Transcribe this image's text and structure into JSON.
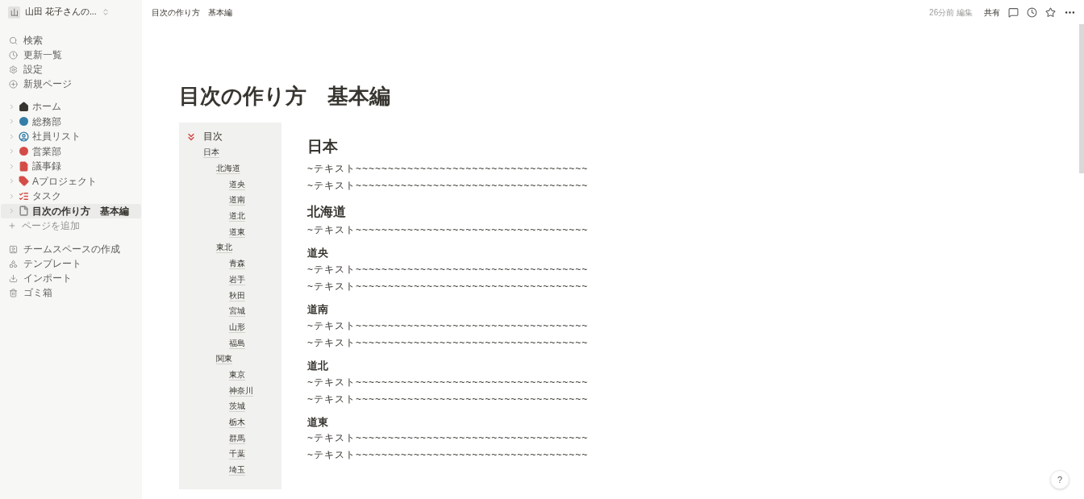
{
  "workspace": {
    "avatar": "山",
    "name": "山田 花子さんの..."
  },
  "breadcrumb": "目次の作り方　基本編",
  "topbar": {
    "edited": "26分前 編集",
    "share": "共有"
  },
  "nav": [
    {
      "kind": "search",
      "label": "検索"
    },
    {
      "kind": "updates",
      "label": "更新一覧"
    },
    {
      "kind": "settings",
      "label": "設定"
    },
    {
      "kind": "new",
      "label": "新規ページ"
    }
  ],
  "pages": [
    {
      "kind": "home",
      "label": "ホーム",
      "color": "#37352f",
      "selected": false
    },
    {
      "kind": "dot",
      "label": "総務部",
      "color": "#337ea9",
      "selected": false
    },
    {
      "kind": "person",
      "label": "社員リスト",
      "color": "#337ea9",
      "selected": false
    },
    {
      "kind": "dot",
      "label": "営業部",
      "color": "#d44c47",
      "selected": false
    },
    {
      "kind": "doc",
      "label": "議事録",
      "color": "#d44c47",
      "selected": false
    },
    {
      "kind": "tag",
      "label": "Aプロジェクト",
      "color": "#d44c47",
      "selected": false
    },
    {
      "kind": "tasks",
      "label": "タスク",
      "color": "#d44c47",
      "selected": false
    },
    {
      "kind": "page",
      "label": "目次の作り方　基本編",
      "color": "#91918e",
      "selected": true
    }
  ],
  "add_page": "ページを追加",
  "footer_nav": [
    {
      "kind": "teamspace",
      "label": "チームスペースの作成"
    },
    {
      "kind": "template",
      "label": "テンプレート"
    },
    {
      "kind": "import",
      "label": "インポート"
    },
    {
      "kind": "trash",
      "label": "ゴミ箱"
    }
  ],
  "page": {
    "title": "目次の作り方　基本編",
    "toc": {
      "title": "目次",
      "items": [
        {
          "label": "日本",
          "children": [
            {
              "label": "北海道",
              "children": [
                {
                  "label": "道央"
                },
                {
                  "label": "道南"
                },
                {
                  "label": "道北"
                },
                {
                  "label": "道東"
                }
              ]
            },
            {
              "label": "東北",
              "children": [
                {
                  "label": "青森"
                },
                {
                  "label": "岩手"
                },
                {
                  "label": "秋田"
                },
                {
                  "label": "宮城"
                },
                {
                  "label": "山形"
                },
                {
                  "label": "福島"
                }
              ]
            },
            {
              "label": "関東",
              "children": [
                {
                  "label": "東京"
                },
                {
                  "label": "神奈川"
                },
                {
                  "label": "茨城"
                },
                {
                  "label": "栃木"
                },
                {
                  "label": "群馬"
                },
                {
                  "label": "千葉"
                },
                {
                  "label": "埼玉"
                }
              ]
            }
          ]
        }
      ]
    },
    "sections": [
      {
        "kind": "h1",
        "heading": "日本",
        "lines": [
          "~テキスト~~~~~~~~~~~~~~~~~~~~~~~~~~~~~~~~~~~~",
          "~テキスト~~~~~~~~~~~~~~~~~~~~~~~~~~~~~~~~~~~~"
        ]
      },
      {
        "kind": "h2",
        "heading": "北海道",
        "lines": [
          "~テキスト~~~~~~~~~~~~~~~~~~~~~~~~~~~~~~~~~~~~"
        ]
      },
      {
        "kind": "h3",
        "heading": "道央",
        "lines": [
          "~テキスト~~~~~~~~~~~~~~~~~~~~~~~~~~~~~~~~~~~~",
          "~テキスト~~~~~~~~~~~~~~~~~~~~~~~~~~~~~~~~~~~~"
        ]
      },
      {
        "kind": "h3",
        "heading": "道南",
        "lines": [
          "~テキスト~~~~~~~~~~~~~~~~~~~~~~~~~~~~~~~~~~~~",
          "~テキスト~~~~~~~~~~~~~~~~~~~~~~~~~~~~~~~~~~~~"
        ]
      },
      {
        "kind": "h3",
        "heading": "道北",
        "lines": [
          "~テキスト~~~~~~~~~~~~~~~~~~~~~~~~~~~~~~~~~~~~",
          "~テキスト~~~~~~~~~~~~~~~~~~~~~~~~~~~~~~~~~~~~"
        ]
      },
      {
        "kind": "h3",
        "heading": "道東",
        "lines": [
          "~テキスト~~~~~~~~~~~~~~~~~~~~~~~~~~~~~~~~~~~~",
          "~テキスト~~~~~~~~~~~~~~~~~~~~~~~~~~~~~~~~~~~~"
        ]
      }
    ]
  },
  "help": "?"
}
